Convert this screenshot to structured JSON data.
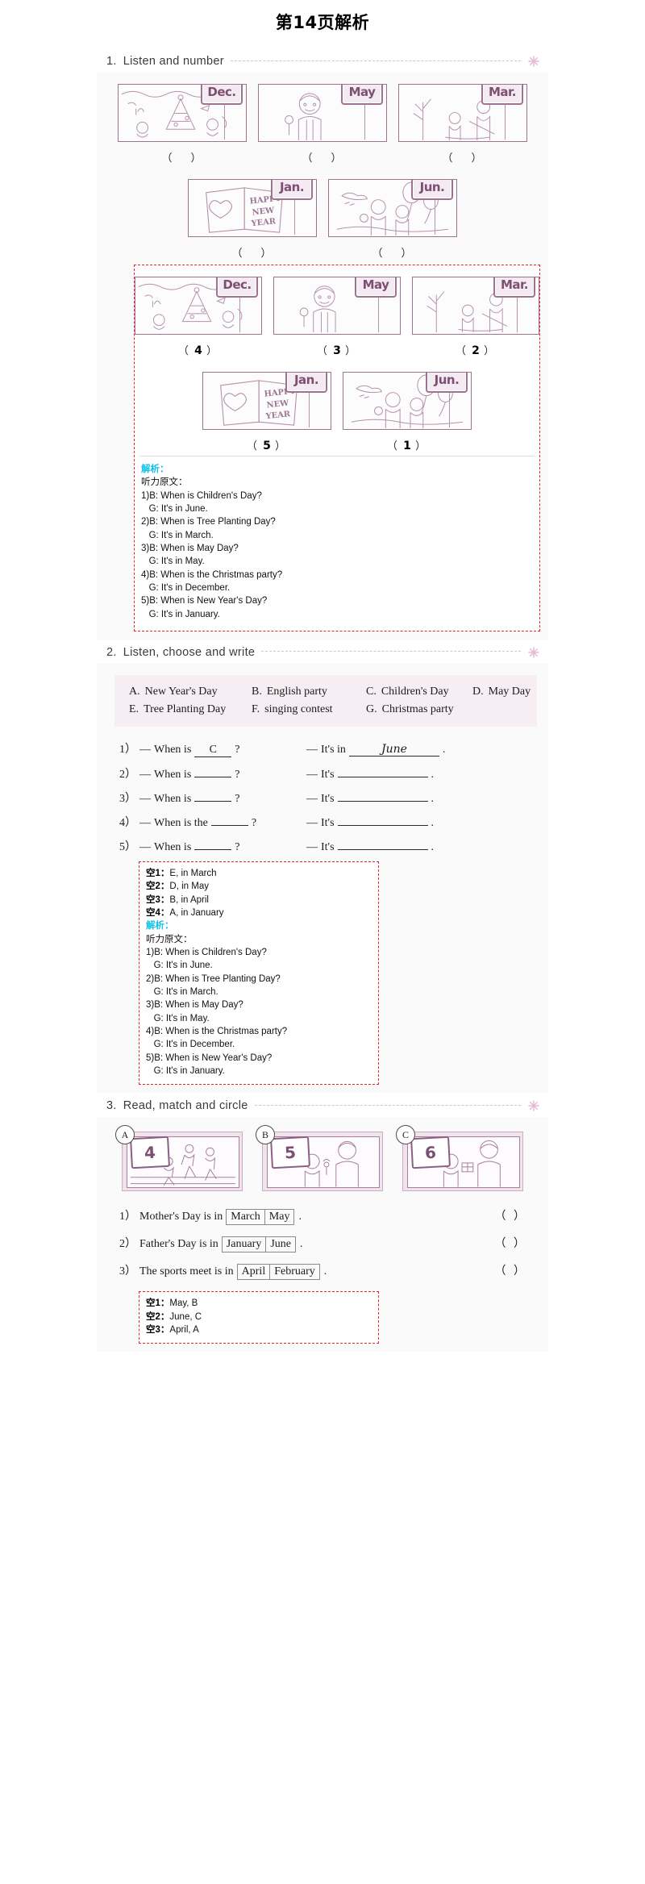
{
  "page": {
    "title": "第14页解析"
  },
  "icons": {
    "star": "star-icon"
  },
  "ex1": {
    "number": "1.",
    "title": "Listen and number",
    "pictures_row1": [
      {
        "month": "Dec.",
        "scene": "christmas-party-scene",
        "answer": ""
      },
      {
        "month": "May",
        "scene": "worker-with-wrench-scene",
        "answer": ""
      },
      {
        "month": "Mar.",
        "scene": "tree-planting-scene",
        "answer": ""
      }
    ],
    "pictures_row2": [
      {
        "month": "Jan.",
        "scene": "happy-new-year-card-scene",
        "answer": ""
      },
      {
        "month": "Jun.",
        "scene": "children-with-balloons-scene",
        "answer": ""
      }
    ],
    "answer_pictures_row1": [
      {
        "month": "Dec.",
        "scene": "christmas-party-scene",
        "answer": "4"
      },
      {
        "month": "May",
        "scene": "worker-with-wrench-scene",
        "answer": "3"
      },
      {
        "month": "Mar.",
        "scene": "tree-planting-scene",
        "answer": "2"
      }
    ],
    "answer_pictures_row2": [
      {
        "month": "Jan.",
        "scene": "happy-new-year-card-scene",
        "answer": "5"
      },
      {
        "month": "Jun.",
        "scene": "children-with-balloons-scene",
        "answer": "1"
      }
    ],
    "explain_label": "解析：",
    "explain_subtitle": "听力原文：",
    "explain_lines": [
      "1)B: When is Children's Day?",
      "   G: It's in June.",
      "2)B: When is Tree Planting Day?",
      "   G: It's in March.",
      "3)B: When is May Day?",
      "   G: It's in May.",
      "4)B: When is the Christmas party?",
      "   G: It's in December.",
      "5)B: When is New Year's Day?",
      "   G: It's in January."
    ],
    "card_text": [
      "HAPPY",
      "NEW",
      "YEAR"
    ]
  },
  "ex2": {
    "number": "2.",
    "title": "Listen, choose and write",
    "wordbank": [
      [
        {
          "letter": "A.",
          "text": "New Year's Day"
        },
        {
          "letter": "B.",
          "text": "English party"
        },
        {
          "letter": "C.",
          "text": "Children's Day"
        },
        {
          "letter": "D.",
          "text": "May Day"
        }
      ],
      [
        {
          "letter": "E.",
          "text": "Tree Planting Day"
        },
        {
          "letter": "F.",
          "text": "singing contest"
        },
        {
          "letter": "G.",
          "text": "Christmas party"
        }
      ]
    ],
    "questions": [
      {
        "num": "1）",
        "dash": "—",
        "q_pre": "When is",
        "q_post": "?",
        "q_blank": "C",
        "a_pre": "It's in",
        "a_blank": "June",
        "a_post": "."
      },
      {
        "num": "2）",
        "dash": "—",
        "q_pre": "When is",
        "q_post": "?",
        "q_blank": "",
        "a_pre": "It's",
        "a_blank": "",
        "a_post": "."
      },
      {
        "num": "3）",
        "dash": "—",
        "q_pre": "When is",
        "q_post": "?",
        "q_blank": "",
        "a_pre": "It's",
        "a_blank": "",
        "a_post": "."
      },
      {
        "num": "4）",
        "dash": "—",
        "q_pre": "When is the",
        "q_post": "?",
        "q_blank": "",
        "a_pre": "It's",
        "a_blank": "",
        "a_post": "."
      },
      {
        "num": "5）",
        "dash": "—",
        "q_pre": "When is",
        "q_post": "?",
        "q_blank": "",
        "a_pre": "It's",
        "a_blank": "",
        "a_post": "."
      }
    ],
    "answers": [
      {
        "kong": "空1：",
        "val": "E, in March"
      },
      {
        "kong": "空2：",
        "val": "D, in May"
      },
      {
        "kong": "空3：",
        "val": "B, in April"
      },
      {
        "kong": "空4：",
        "val": "A, in January"
      }
    ],
    "explain_label": "解析：",
    "explain_subtitle": "听力原文：",
    "explain_lines": [
      "1)B: When is Children's Day?",
      "   G: It's in June.",
      "2)B: When is Tree Planting Day?",
      "   G: It's in March.",
      "3)B: When is May Day?",
      "   G: It's in May.",
      "4)B: When is the Christmas party?",
      "   G: It's in December.",
      "5)B: When is New Year's Day?",
      "   G: It's in January."
    ]
  },
  "ex3": {
    "number": "3.",
    "title": "Read, match and circle",
    "stamps": [
      {
        "badge": "A",
        "cal": "4",
        "scene": "sports-meet-running-scene"
      },
      {
        "badge": "B",
        "cal": "5",
        "scene": "mother-and-child-flowers-scene"
      },
      {
        "badge": "C",
        "cal": "6",
        "scene": "father-and-child-gift-scene"
      }
    ],
    "questions": [
      {
        "num": "1）",
        "text": "Mother's Day is in",
        "options": [
          "March",
          "May"
        ],
        "end": ".",
        "tail": "（    ）"
      },
      {
        "num": "2）",
        "text": "Father's Day is in",
        "options": [
          "January",
          "June"
        ],
        "end": ".",
        "tail": "（    ）"
      },
      {
        "num": "3）",
        "text": "The sports meet is in",
        "options": [
          "April",
          "February"
        ],
        "end": ".",
        "tail": "（    ）"
      }
    ],
    "answers": [
      {
        "kong": "空1：",
        "val": "May, B"
      },
      {
        "kong": "空2：",
        "val": "June, C"
      },
      {
        "kong": "空3：",
        "val": "April, A"
      }
    ]
  },
  "colors": {
    "accent_purple": "#9d7490",
    "answer_red": "#e8262f",
    "explain_cyan": "#12c2ea",
    "wordbank_pink": "#f7eef3",
    "star_pink": "#e8b9d4"
  }
}
